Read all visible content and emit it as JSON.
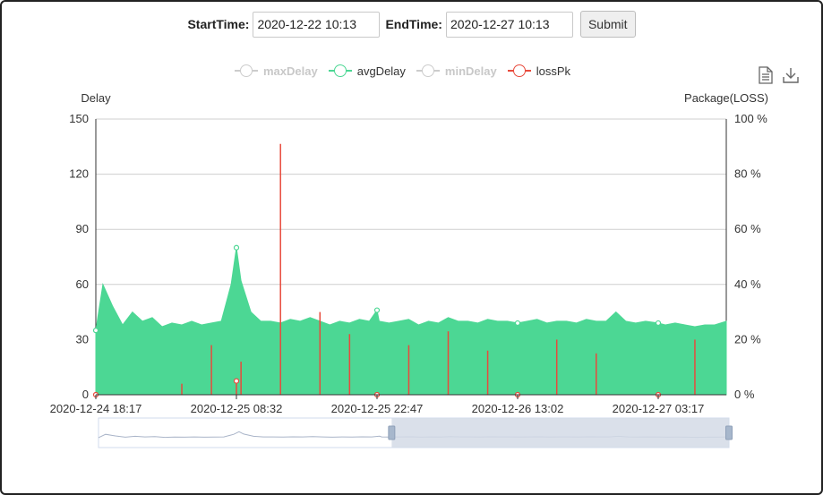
{
  "form": {
    "start_label": "StartTime:",
    "start_value": "2020-12-22 10:13",
    "end_label": "EndTime:",
    "end_value": "2020-12-27 10:13",
    "submit_label": "Submit"
  },
  "toolbox": {
    "icons": [
      "data-view-icon",
      "download-icon"
    ]
  },
  "colors": {
    "avgDelay": "#4cd794",
    "lossPk": "#e84a3c",
    "disabled": "#cccccc",
    "grid": "#cfcfcf",
    "zoom_fill": "#d3dbe6"
  },
  "chart_data": {
    "type": "area",
    "legend": [
      {
        "name": "maxDelay",
        "enabled": false
      },
      {
        "name": "avgDelay",
        "enabled": true
      },
      {
        "name": "minDelay",
        "enabled": false
      },
      {
        "name": "lossPk",
        "enabled": true
      }
    ],
    "legend_position": "top-center",
    "y_left": {
      "title": "Delay",
      "min": 0,
      "max": 150,
      "ticks": [
        0,
        30,
        60,
        90,
        120,
        150
      ],
      "tick_labels": [
        "0",
        "30",
        "60",
        "90",
        "120",
        "150"
      ]
    },
    "y_right": {
      "title": "Package(LOSS)",
      "min": 0,
      "max": 100,
      "ticks": [
        0,
        20,
        40,
        60,
        80,
        100
      ],
      "tick_labels": [
        "0 %",
        "20 %",
        "40 %",
        "60 %",
        "80 %",
        "100 %"
      ]
    },
    "x_ticks": [
      "2020-12-24 18:17",
      "2020-12-25 08:32",
      "2020-12-25 22:47",
      "2020-12-26 13:02",
      "2020-12-27 03:17"
    ],
    "grid": true,
    "series": [
      {
        "name": "avgDelay",
        "axis": "left",
        "x": [
          "2020-12-24 18:17",
          "2020-12-24 19:00",
          "2020-12-24 20:00",
          "2020-12-24 21:00",
          "2020-12-24 22:00",
          "2020-12-24 23:00",
          "2020-12-25 00:00",
          "2020-12-25 01:00",
          "2020-12-25 02:00",
          "2020-12-25 03:00",
          "2020-12-25 04:00",
          "2020-12-25 05:00",
          "2020-12-25 06:00",
          "2020-12-25 07:00",
          "2020-12-25 08:00",
          "2020-12-25 08:32",
          "2020-12-25 09:00",
          "2020-12-25 10:00",
          "2020-12-25 11:00",
          "2020-12-25 12:00",
          "2020-12-25 13:00",
          "2020-12-25 14:00",
          "2020-12-25 15:00",
          "2020-12-25 16:00",
          "2020-12-25 17:00",
          "2020-12-25 18:00",
          "2020-12-25 19:00",
          "2020-12-25 20:00",
          "2020-12-25 21:00",
          "2020-12-25 22:00",
          "2020-12-25 22:47",
          "2020-12-25 23:00",
          "2020-12-26 00:00",
          "2020-12-26 01:00",
          "2020-12-26 02:00",
          "2020-12-26 03:00",
          "2020-12-26 04:00",
          "2020-12-26 05:00",
          "2020-12-26 06:00",
          "2020-12-26 07:00",
          "2020-12-26 08:00",
          "2020-12-26 09:00",
          "2020-12-26 10:00",
          "2020-12-26 11:00",
          "2020-12-26 12:00",
          "2020-12-26 13:02",
          "2020-12-26 14:00",
          "2020-12-26 15:00",
          "2020-12-26 16:00",
          "2020-12-26 17:00",
          "2020-12-26 18:00",
          "2020-12-26 19:00",
          "2020-12-26 20:00",
          "2020-12-26 21:00",
          "2020-12-26 22:00",
          "2020-12-26 23:00",
          "2020-12-27 00:00",
          "2020-12-27 01:00",
          "2020-12-27 02:00",
          "2020-12-27 03:17",
          "2020-12-27 04:00",
          "2020-12-27 05:00",
          "2020-12-27 06:00",
          "2020-12-27 07:00",
          "2020-12-27 08:00",
          "2020-12-27 09:00",
          "2020-12-27 10:13"
        ],
        "values": [
          35,
          60,
          48,
          38,
          45,
          40,
          42,
          37,
          39,
          38,
          40,
          38,
          39,
          40,
          60,
          80,
          62,
          45,
          40,
          40,
          39,
          41,
          40,
          42,
          40,
          38,
          40,
          39,
          41,
          40,
          46,
          40,
          39,
          40,
          41,
          38,
          40,
          39,
          42,
          40,
          40,
          39,
          41,
          40,
          40,
          39,
          40,
          41,
          39,
          40,
          40,
          39,
          41,
          40,
          40,
          45,
          40,
          39,
          40,
          39,
          38,
          39,
          38,
          37,
          38,
          38,
          40
        ]
      },
      {
        "name": "lossPk",
        "axis": "right",
        "x": [
          "2020-12-24 18:17",
          "2020-12-25 03:00",
          "2020-12-25 06:00",
          "2020-12-25 08:32",
          "2020-12-25 09:00",
          "2020-12-25 13:00",
          "2020-12-25 17:00",
          "2020-12-25 20:00",
          "2020-12-25 22:47",
          "2020-12-26 02:00",
          "2020-12-26 06:00",
          "2020-12-26 10:00",
          "2020-12-26 13:02",
          "2020-12-26 17:00",
          "2020-12-26 21:00",
          "2020-12-27 03:17",
          "2020-12-27 07:00",
          "2020-12-27 10:13"
        ],
        "values": [
          0,
          4,
          18,
          5,
          12,
          91,
          30,
          22,
          0,
          18,
          23,
          16,
          0,
          20,
          15,
          0,
          20,
          0
        ]
      }
    ],
    "dataZoom": {
      "start_percent": 46.5,
      "end_percent": 100
    }
  }
}
